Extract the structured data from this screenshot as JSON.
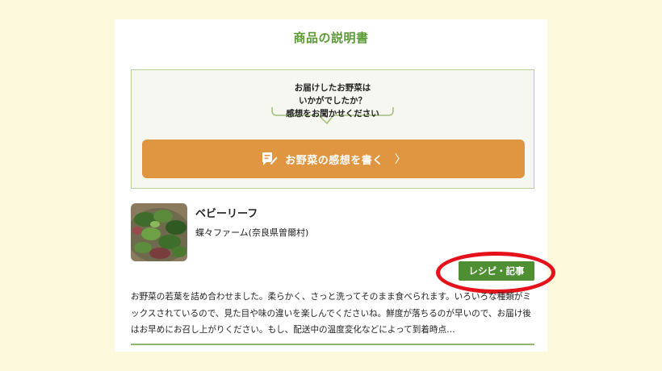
{
  "page": {
    "title": "商品の説明書"
  },
  "feedback": {
    "bubble_lines": [
      "お届けしたお野菜は",
      "いかがでしたか？",
      "感想をお聞かせください"
    ],
    "review_button_label": "お野菜の感想を書く",
    "review_button_chevron": "〉",
    "review_button_icon": "pen-memo-icon"
  },
  "product": {
    "name": "ベビーリーフ",
    "farm": "蝶々ファーム(奈良県曽爾村)",
    "recipe_button_label": "レシピ・記事",
    "description": "お野菜の若葉を詰め合わせました。柔らかく、さっと洗ってそのまま食べられます。いろいろな種類がミックスされているので、見た目や味の違いを楽しんでくださいね。鮮度が落ちるのが早いので、お届け後はお早めにお召し上がりください。もし、配送中の温度変化などによって到着時点…"
  },
  "colors": {
    "background": "#fdf9dc",
    "title_green": "#5a9a34",
    "review_orange": "#e09641",
    "recipe_green": "#4f8f33",
    "highlight_red": "#e5121b"
  }
}
